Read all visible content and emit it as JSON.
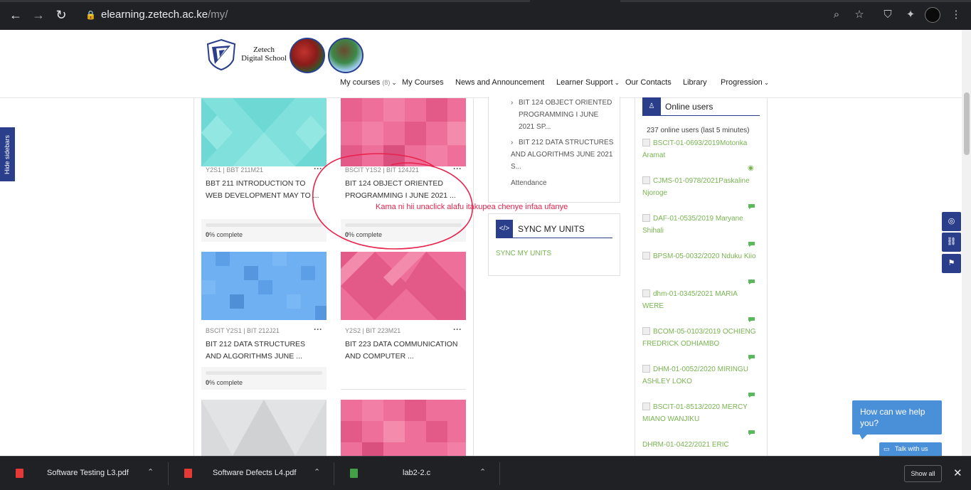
{
  "browser": {
    "url_host": "elearning.zetech.ac.ke",
    "url_path": "/my/"
  },
  "site": {
    "logo_line1": "Zetech",
    "logo_line2": "Digital School",
    "menu": [
      {
        "label": "My courses",
        "count": "(8)"
      },
      {
        "label": "My Courses"
      },
      {
        "label": "News and Announcement"
      },
      {
        "label": "Learner Support"
      },
      {
        "label": "Our Contacts"
      },
      {
        "label": "Library"
      },
      {
        "label": "Progression"
      }
    ],
    "hide_sidebars": "Hide sidebars"
  },
  "courses": [
    {
      "meta": "Y2S1 | BBT 211M21",
      "title": "BBT 211 INTRODUCTION TO WEB DEVELOPMENT MAY TO ...",
      "progress_value": "0",
      "progress_suffix": "% complete",
      "progress": 0,
      "color": "#7fe0dc"
    },
    {
      "meta": "BSCIT Y1S2 | BIT 124J21",
      "title": "BIT 124 OBJECT ORIENTED PROGRAMMING I JUNE 2021 ...",
      "progress_value": "0",
      "progress_suffix": "% complete",
      "progress": 0,
      "color": "#ee6f99"
    },
    {
      "meta": "BSCIT Y2S1 | BIT 212J21",
      "title": "BIT 212 DATA STRUCTURES AND ALGORITHMS JUNE ...",
      "progress_value": "0",
      "progress_suffix": "% complete",
      "progress": 0,
      "color": "#6fb0f2"
    },
    {
      "meta": "Y2S2 | BIT 223M21",
      "title": "BIT 223 DATA COMMUNICATION AND COMPUTER ...",
      "color": "#ee6f99"
    },
    {
      "color": "#d8dadc"
    },
    {
      "color": "#ee6f99"
    }
  ],
  "annotation": "Kama ni hii unaclick alafu itakupea chenye infaa ufanye",
  "middle": {
    "links": [
      "BIT 124 OBJECT ORIENTED PROGRAMMING I JUNE 2021 SP...",
      "BIT 212 DATA STRUCTURES AND ALGORITHMS JUNE 2021 S..."
    ],
    "attendance": "Attendance",
    "sync_title": "SYNC MY UNITS",
    "sync_link": "SYNC MY UNITS"
  },
  "online": {
    "title": "Online users",
    "count": "237 online users (last 5 minutes)",
    "users": [
      "BSCIT-01-0693/2019Motonka Aramat",
      "CJMS-01-0978/2021Paskaline Njoroge",
      "DAF-01-0535/2019 Maryane Shihali",
      "BPSM-05-0032/2020 Nduku Kiio",
      "dhm-01-0345/2021 MARIA WERE",
      "BCOM-05-0103/2019 OCHIENG FREDRICK ODHIAMBO",
      "DHM-01-0052/2020 MIRINGU ASHLEY LOKO",
      "BSCIT-01-8513/2020 MERCY MIANO WANJIKU",
      "DHRM-01-0422/2021 ERIC"
    ]
  },
  "chat": {
    "help": "How can we help you?",
    "talk": "Talk with us"
  },
  "downloads": {
    "items": [
      "Software Testing L3.pdf",
      "Software Defects L4.pdf",
      "lab2-2.c"
    ],
    "show_all": "Show all"
  }
}
